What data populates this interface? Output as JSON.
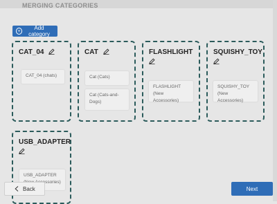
{
  "page": {
    "title": "MERGING CATEGORIES"
  },
  "toolbar": {
    "add_label": "Add category"
  },
  "cards": [
    {
      "name": "CAT_04",
      "items": [
        "CAT_04 (chats)"
      ]
    },
    {
      "name": "CAT",
      "items": [
        "Cat (Cats)",
        "Cat (Cats-and-Dogs)"
      ]
    },
    {
      "name": "FLASHLIGHT",
      "items": [
        "FLASHLIGHT (New Accessories)"
      ]
    },
    {
      "name": "SQUISHY_TOY",
      "items": [
        "SQUISHY_TOY (New Accessories)"
      ]
    },
    {
      "name": "USB_ADAPTER",
      "items": [
        "USB_ADAPTER (New Accessories)"
      ]
    }
  ],
  "footer": {
    "back_label": "Back",
    "next_label": "Next"
  },
  "colors": {
    "accent": "#2f6db7",
    "card_border": "#2b5b5b"
  }
}
